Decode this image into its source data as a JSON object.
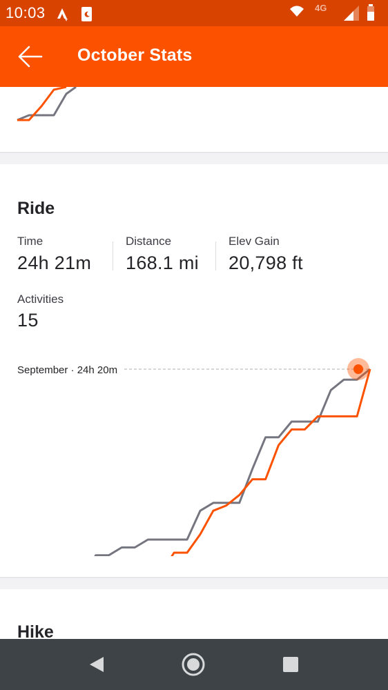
{
  "status_bar": {
    "time": "10:03",
    "network": "4G",
    "icons": [
      "strava-notification-icon",
      "sleep-mode-icon",
      "wifi-icon",
      "signal-icon",
      "battery-icon"
    ]
  },
  "app_bar": {
    "title": "October Stats",
    "back_icon": "arrow-left-icon",
    "color": "#fc5200"
  },
  "ride": {
    "title": "Ride",
    "stats": [
      {
        "label": "Time",
        "value": "24h 21m"
      },
      {
        "label": "Distance",
        "value": "168.1 mi"
      },
      {
        "label": "Elev Gain",
        "value": "20,798 ft"
      },
      {
        "label": "Activities",
        "value": "15"
      }
    ],
    "comparison_label": "September · 24h 20m"
  },
  "hike": {
    "title": "Hike"
  },
  "chart_data": {
    "type": "line",
    "title": "",
    "series": [
      {
        "name": "",
        "color": "#757580",
        "values": [
          0.0,
          0.04,
          0.04,
          0.04,
          0.13,
          0.19,
          0.29,
          0.29,
          0.32,
          0.32,
          0.35,
          0.35,
          0.35,
          0.35,
          0.46,
          0.49,
          0.49,
          0.49,
          0.62,
          0.74,
          0.74,
          0.8,
          0.8,
          0.8,
          0.92,
          0.96,
          0.96,
          1.0
        ]
      },
      {
        "name": "",
        "color": "#fc5200",
        "values": [
          0.0,
          0.0,
          0.0,
          0.04,
          0.07,
          0.07,
          0.12,
          0.12,
          0.22,
          0.22,
          0.22,
          0.22,
          0.3,
          0.3,
          0.37,
          0.46,
          0.48,
          0.52,
          0.58,
          0.58,
          0.71,
          0.77,
          0.77,
          0.82,
          0.82,
          0.82,
          0.82,
          1.0
        ]
      }
    ],
    "colors": {
      "current": "#fc5200",
      "previous": "#757580",
      "reference_line": "#bdbdbd"
    }
  },
  "nav_bar": {
    "buttons": [
      "back-triangle-icon",
      "home-circle-icon",
      "recents-square-icon"
    ]
  }
}
